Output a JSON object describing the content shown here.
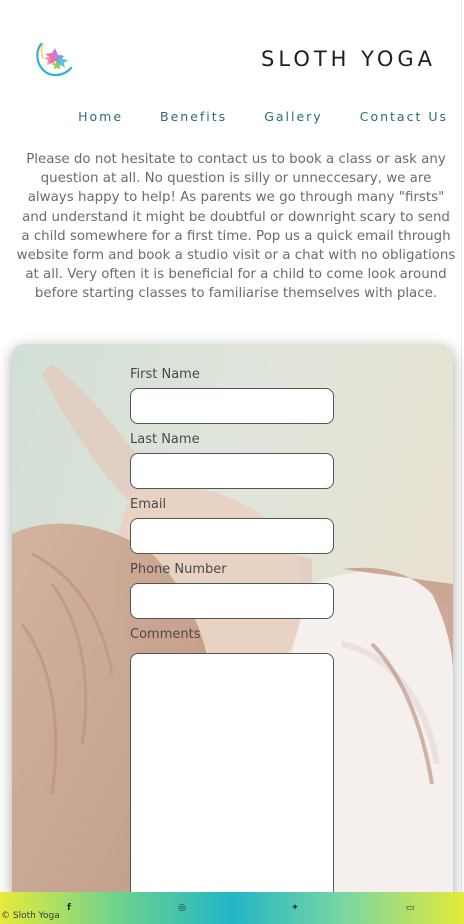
{
  "header": {
    "brand": "SLOTH YOGA"
  },
  "nav": {
    "items": [
      "Home",
      "Benefits",
      "Gallery",
      "Contact Us"
    ]
  },
  "intro": {
    "text": "Please do not hesitate to contact us to book a class or ask any question at all. No question is silly or unneccesary, we are always happy to help! As parents we go through many \"firsts\" and understand it might be doubtful or downright scary to send a child somewhere for a first time. Pop us a quick email through website form and book a studio visit or a chat with no obligations at all. Very often it is beneficial for a child to come look around before starting classes to familiarise themselves with place."
  },
  "form": {
    "first_name_label": "First Name",
    "first_name_value": "",
    "last_name_label": "Last Name",
    "last_name_value": "",
    "email_label": "Email",
    "email_value": "",
    "phone_label": "Phone Number",
    "phone_value": "",
    "comments_label": "Comments",
    "comments_value": ""
  },
  "footer": {
    "social_icons": [
      "facebook-icon",
      "instagram-icon",
      "twitter-icon",
      "email-icon"
    ],
    "social_glyphs": [
      "f",
      "◎",
      "✦",
      "▭"
    ],
    "copyright": "© Sloth Yoga"
  },
  "colors": {
    "brand_text": "#1f1f1f",
    "nav_text": "#2d6c73",
    "gradient_start": "#e8ea3a",
    "gradient_mid": "#22b6c6",
    "gradient_end": "#e3ea3a"
  }
}
